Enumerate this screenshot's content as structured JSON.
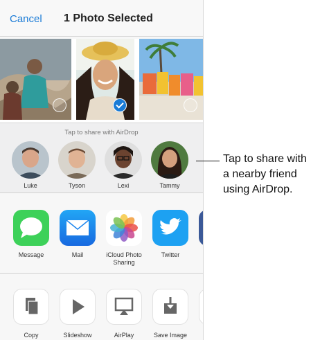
{
  "nav": {
    "cancel_label": "Cancel",
    "title": "1 Photo Selected"
  },
  "photos": [
    {
      "selected": false
    },
    {
      "selected": true
    },
    {
      "selected": false
    }
  ],
  "airdrop": {
    "hint": "Tap to share with AirDrop",
    "contacts": [
      "Luke",
      "Tyson",
      "Lexi",
      "Tammy"
    ]
  },
  "apps": [
    {
      "label": "Message",
      "icon": "message-icon"
    },
    {
      "label": "Mail",
      "icon": "mail-icon"
    },
    {
      "label": "iCloud Photo Sharing",
      "icon": "photos-icon"
    },
    {
      "label": "Twitter",
      "icon": "twitter-icon"
    },
    {
      "label": "F",
      "icon": "facebook-icon"
    }
  ],
  "actions": [
    {
      "label": "Copy",
      "icon": "copy-icon"
    },
    {
      "label": "Slideshow",
      "icon": "play-icon"
    },
    {
      "label": "AirPlay",
      "icon": "airplay-icon"
    },
    {
      "label": "Save Image",
      "icon": "save-image-icon"
    },
    {
      "label": "A",
      "icon": "more-action-icon"
    }
  ],
  "callout": "Tap to share with\na nearby friend\nusing AirDrop.",
  "colors": {
    "accent": "#1a7bd6",
    "message_green": "#3dd159",
    "mail_blue": "#1f87ee",
    "twitter_blue": "#1da1f2",
    "facebook_blue": "#3b5998"
  }
}
